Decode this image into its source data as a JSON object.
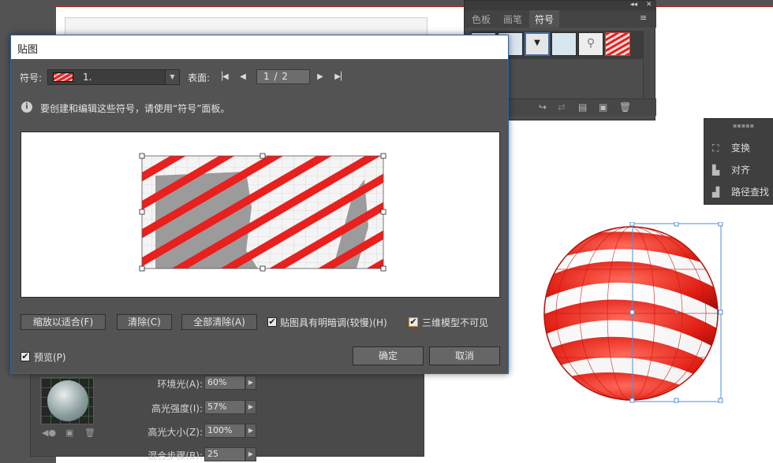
{
  "symbol_panel": {
    "tabs": [
      "色板",
      "画笔",
      "符号"
    ],
    "active_tab": "符号",
    "controls": [
      "◂◂",
      "✕"
    ],
    "menu_icon": "≡"
  },
  "right_panel": {
    "items": [
      {
        "label": "变换",
        "icon": "transform-icon"
      },
      {
        "label": "对齐",
        "icon": "align-icon"
      },
      {
        "label": "路径查找",
        "icon": "pathfinder-icon"
      }
    ]
  },
  "bg_options": {
    "rows": [
      {
        "label": "环境光(A):",
        "value": "60%"
      },
      {
        "label": "高光强度(I):",
        "value": "57%"
      },
      {
        "label": "高光大小(Z):",
        "value": "100%"
      },
      {
        "label": "混合步骤(B):",
        "value": "25"
      }
    ]
  },
  "dialog": {
    "title": "贴图",
    "symbol_label": "符号:",
    "symbol_value": "1.",
    "surface_label": "表面:",
    "page_value": "1 / 2",
    "info_text": "要创建和编辑这些符号，请使用“符号”面板。",
    "buttons": {
      "fit": "缩放以适合(F)",
      "clear": "清除(C)",
      "clear_all": "全部清除(A)",
      "ok": "确定",
      "cancel": "取消"
    },
    "checkboxes": {
      "shade": {
        "label": "贴图具有明暗调(较慢)(H)",
        "checked": true
      },
      "invisible": {
        "label": "三维模型不可见",
        "checked": true
      },
      "preview": {
        "label": "预览(P)",
        "checked": true
      }
    }
  },
  "colors": {
    "stripe_red": "#e8201e",
    "dialog_bg": "#535353",
    "selection_blue": "#4f8fd8"
  }
}
